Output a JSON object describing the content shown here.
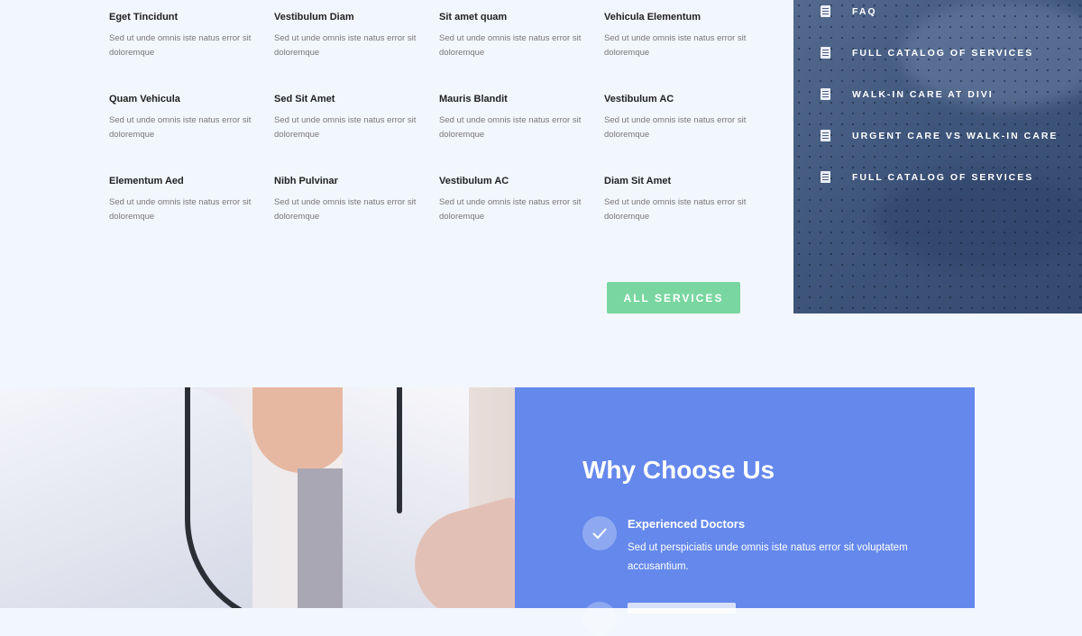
{
  "services": {
    "items": [
      {
        "title": "Eget Tincidunt",
        "desc": "Sed ut unde omnis iste natus error sit doloremque"
      },
      {
        "title": "Vestibulum Diam",
        "desc": "Sed ut unde omnis iste natus error sit doloremque"
      },
      {
        "title": "Sit amet quam",
        "desc": "Sed ut unde omnis iste natus error sit doloremque"
      },
      {
        "title": "Vehicula Elementum",
        "desc": "Sed ut unde omnis iste natus error sit doloremque"
      },
      {
        "title": "Quam Vehicula",
        "desc": "Sed ut unde omnis iste natus error sit doloremque"
      },
      {
        "title": "Sed Sit Amet",
        "desc": "Sed ut unde omnis iste natus error sit doloremque"
      },
      {
        "title": "Mauris Blandit",
        "desc": "Sed ut unde omnis iste natus error sit doloremque"
      },
      {
        "title": "Vestibulum AC",
        "desc": "Sed ut unde omnis iste natus error sit doloremque"
      },
      {
        "title": "Elementum Aed",
        "desc": "Sed ut unde omnis iste natus error sit doloremque"
      },
      {
        "title": "Nibh Pulvinar",
        "desc": "Sed ut unde omnis iste natus error sit doloremque"
      },
      {
        "title": "Vestibulum AC",
        "desc": "Sed ut unde omnis iste natus error sit doloremque"
      },
      {
        "title": "Diam Sit Amet",
        "desc": "Sed ut unde omnis iste natus error sit doloremque"
      }
    ],
    "button_label": "ALL SERVICES"
  },
  "side_menu": {
    "items": [
      {
        "label": "FAQ",
        "icon": "document-icon"
      },
      {
        "label": "FULL CATALOG OF SERVICES",
        "icon": "document-icon"
      },
      {
        "label": "WALK-IN CARE AT DIVI",
        "icon": "document-icon"
      },
      {
        "label": "URGENT CARE VS WALK-IN CARE",
        "icon": "document-icon"
      },
      {
        "label": "FULL CATALOG OF SERVICES",
        "icon": "document-icon"
      }
    ]
  },
  "why": {
    "title": "Why Choose Us",
    "features": [
      {
        "title": "Experienced Doctors",
        "desc": "Sed ut perspiciatis unde omnis iste natus error sit voluptatem accusantium.",
        "icon": "check-icon"
      }
    ]
  },
  "colors": {
    "background": "#f2f6fd",
    "button": "#7ad6a0",
    "why_panel": "#6488ec",
    "side_panel": "#3f567c"
  }
}
